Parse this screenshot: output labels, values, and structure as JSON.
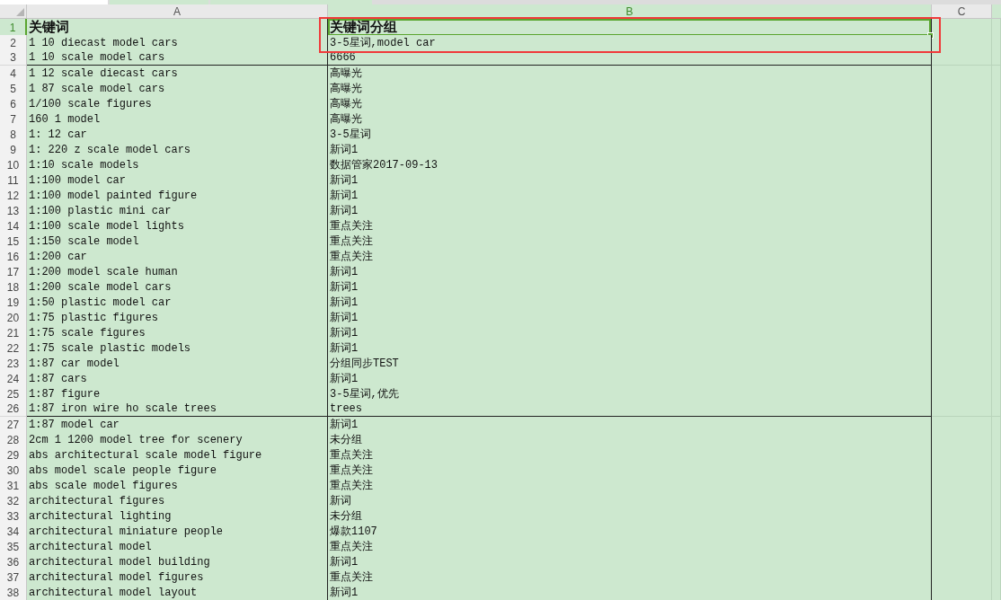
{
  "columns": [
    {
      "label": "A",
      "selected": false
    },
    {
      "label": "B",
      "selected": true
    },
    {
      "label": "C",
      "selected": false
    }
  ],
  "rows": [
    {
      "number": "1",
      "kind": "header",
      "selected": true,
      "cells": [
        {
          "text": "关键词",
          "selected": false
        },
        {
          "text": "关键词分组",
          "selected": true
        }
      ]
    },
    {
      "number": "2",
      "kind": "data",
      "selected": false,
      "cells": [
        {
          "text": "1 10 diecast model cars",
          "selected": false
        },
        {
          "text": "3-5星词,model car",
          "selected": false
        }
      ]
    },
    {
      "number": "3",
      "kind": "data",
      "selected": false,
      "cells": [
        {
          "text": "1 10 scale model cars",
          "selected": false
        },
        {
          "text": "6666",
          "selected": false
        }
      ]
    },
    {
      "number": "4",
      "kind": "data",
      "selected": false,
      "cells": [
        {
          "text": "1 12 scale diecast cars",
          "selected": false
        },
        {
          "text": "高曝光",
          "selected": false
        }
      ]
    },
    {
      "number": "5",
      "kind": "data",
      "selected": false,
      "cells": [
        {
          "text": "1 87 scale model cars",
          "selected": false
        },
        {
          "text": "高曝光",
          "selected": false
        }
      ]
    },
    {
      "number": "6",
      "kind": "data",
      "selected": false,
      "cells": [
        {
          "text": "1/100 scale figures",
          "selected": false
        },
        {
          "text": "高曝光",
          "selected": false
        }
      ]
    },
    {
      "number": "7",
      "kind": "data",
      "selected": false,
      "cells": [
        {
          "text": "160 1 model",
          "selected": false
        },
        {
          "text": "高曝光",
          "selected": false
        }
      ]
    },
    {
      "number": "8",
      "kind": "data",
      "selected": false,
      "cells": [
        {
          "text": "1: 12 car",
          "selected": false
        },
        {
          "text": "3-5星词",
          "selected": false
        }
      ]
    },
    {
      "number": "9",
      "kind": "data",
      "selected": false,
      "cells": [
        {
          "text": "1: 220 z scale model cars",
          "selected": false
        },
        {
          "text": "新词1",
          "selected": false
        }
      ]
    },
    {
      "number": "10",
      "kind": "data",
      "selected": false,
      "cells": [
        {
          "text": "1:10 scale models",
          "selected": false
        },
        {
          "text": "数据管家2017-09-13",
          "selected": false
        }
      ]
    },
    {
      "number": "11",
      "kind": "data",
      "selected": false,
      "cells": [
        {
          "text": "1:100 model car",
          "selected": false
        },
        {
          "text": "新词1",
          "selected": false
        }
      ]
    },
    {
      "number": "12",
      "kind": "data",
      "selected": false,
      "cells": [
        {
          "text": "1:100 model painted figure",
          "selected": false
        },
        {
          "text": "新词1",
          "selected": false
        }
      ]
    },
    {
      "number": "13",
      "kind": "data",
      "selected": false,
      "cells": [
        {
          "text": "1:100 plastic mini car",
          "selected": false
        },
        {
          "text": "新词1",
          "selected": false
        }
      ]
    },
    {
      "number": "14",
      "kind": "data",
      "selected": false,
      "cells": [
        {
          "text": "1:100 scale model lights",
          "selected": false
        },
        {
          "text": "重点关注",
          "selected": false
        }
      ]
    },
    {
      "number": "15",
      "kind": "data",
      "selected": false,
      "cells": [
        {
          "text": "1:150 scale model",
          "selected": false
        },
        {
          "text": "重点关注",
          "selected": false
        }
      ]
    },
    {
      "number": "16",
      "kind": "data",
      "selected": false,
      "cells": [
        {
          "text": "1:200 car",
          "selected": false
        },
        {
          "text": "重点关注",
          "selected": false
        }
      ]
    },
    {
      "number": "17",
      "kind": "data",
      "selected": false,
      "cells": [
        {
          "text": "1:200 model scale human",
          "selected": false
        },
        {
          "text": "新词1",
          "selected": false
        }
      ]
    },
    {
      "number": "18",
      "kind": "data",
      "selected": false,
      "cells": [
        {
          "text": "1:200 scale model cars",
          "selected": false
        },
        {
          "text": "新词1",
          "selected": false
        }
      ]
    },
    {
      "number": "19",
      "kind": "data",
      "selected": false,
      "cells": [
        {
          "text": "1:50 plastic model car",
          "selected": false
        },
        {
          "text": "新词1",
          "selected": false
        }
      ]
    },
    {
      "number": "20",
      "kind": "data",
      "selected": false,
      "cells": [
        {
          "text": "1:75 plastic figures",
          "selected": false
        },
        {
          "text": "新词1",
          "selected": false
        }
      ]
    },
    {
      "number": "21",
      "kind": "data",
      "selected": false,
      "cells": [
        {
          "text": "1:75 scale figures",
          "selected": false
        },
        {
          "text": "新词1",
          "selected": false
        }
      ]
    },
    {
      "number": "22",
      "kind": "data",
      "selected": false,
      "cells": [
        {
          "text": "1:75 scale plastic models",
          "selected": false
        },
        {
          "text": "新词1",
          "selected": false
        }
      ]
    },
    {
      "number": "23",
      "kind": "data",
      "selected": false,
      "cells": [
        {
          "text": "1:87 car model",
          "selected": false
        },
        {
          "text": "分组同步TEST",
          "selected": false
        }
      ]
    },
    {
      "number": "24",
      "kind": "data",
      "selected": false,
      "cells": [
        {
          "text": "1:87 cars",
          "selected": false
        },
        {
          "text": "新词1",
          "selected": false
        }
      ]
    },
    {
      "number": "25",
      "kind": "data",
      "selected": false,
      "cells": [
        {
          "text": "1:87 figure",
          "selected": false
        },
        {
          "text": "3-5星词,优先",
          "selected": false
        }
      ]
    },
    {
      "number": "26",
      "kind": "data",
      "selected": false,
      "cells": [
        {
          "text": "1:87 iron wire ho scale trees",
          "selected": false
        },
        {
          "text": "trees",
          "selected": false
        }
      ]
    },
    {
      "number": "27",
      "kind": "data",
      "selected": false,
      "cells": [
        {
          "text": "1:87 model car",
          "selected": false
        },
        {
          "text": "新词1",
          "selected": false
        }
      ]
    },
    {
      "number": "28",
      "kind": "data",
      "selected": false,
      "cells": [
        {
          "text": "2cm 1 1200 model tree for scenery",
          "selected": false
        },
        {
          "text": "未分组",
          "selected": false
        }
      ]
    },
    {
      "number": "29",
      "kind": "data",
      "selected": false,
      "cells": [
        {
          "text": "abs architectural scale model figure",
          "selected": false
        },
        {
          "text": "重点关注",
          "selected": false
        }
      ]
    },
    {
      "number": "30",
      "kind": "data",
      "selected": false,
      "cells": [
        {
          "text": "abs model scale people figure",
          "selected": false
        },
        {
          "text": "重点关注",
          "selected": false
        }
      ]
    },
    {
      "number": "31",
      "kind": "data",
      "selected": false,
      "cells": [
        {
          "text": "abs scale model figures",
          "selected": false
        },
        {
          "text": "重点关注",
          "selected": false
        }
      ]
    },
    {
      "number": "32",
      "kind": "data",
      "selected": false,
      "cells": [
        {
          "text": "architectural figures",
          "selected": false
        },
        {
          "text": "新词",
          "selected": false
        }
      ]
    },
    {
      "number": "33",
      "kind": "data",
      "selected": false,
      "cells": [
        {
          "text": "architectural lighting",
          "selected": false
        },
        {
          "text": "未分组",
          "selected": false
        }
      ]
    },
    {
      "number": "34",
      "kind": "data",
      "selected": false,
      "cells": [
        {
          "text": "architectural miniature people",
          "selected": false
        },
        {
          "text": "爆款1107",
          "selected": false
        }
      ]
    },
    {
      "number": "35",
      "kind": "data",
      "selected": false,
      "cells": [
        {
          "text": "architectural model",
          "selected": false
        },
        {
          "text": "重点关注",
          "selected": false
        }
      ]
    },
    {
      "number": "36",
      "kind": "data",
      "selected": false,
      "cells": [
        {
          "text": "architectural model building",
          "selected": false
        },
        {
          "text": "新词1",
          "selected": false
        }
      ]
    },
    {
      "number": "37",
      "kind": "data",
      "selected": false,
      "cells": [
        {
          "text": "architectural model figures",
          "selected": false
        },
        {
          "text": "重点关注",
          "selected": false
        }
      ]
    },
    {
      "number": "38",
      "kind": "data",
      "selected": false,
      "cells": [
        {
          "text": "architectural model layout",
          "selected": false
        },
        {
          "text": "新词1",
          "selected": false
        }
      ]
    }
  ]
}
